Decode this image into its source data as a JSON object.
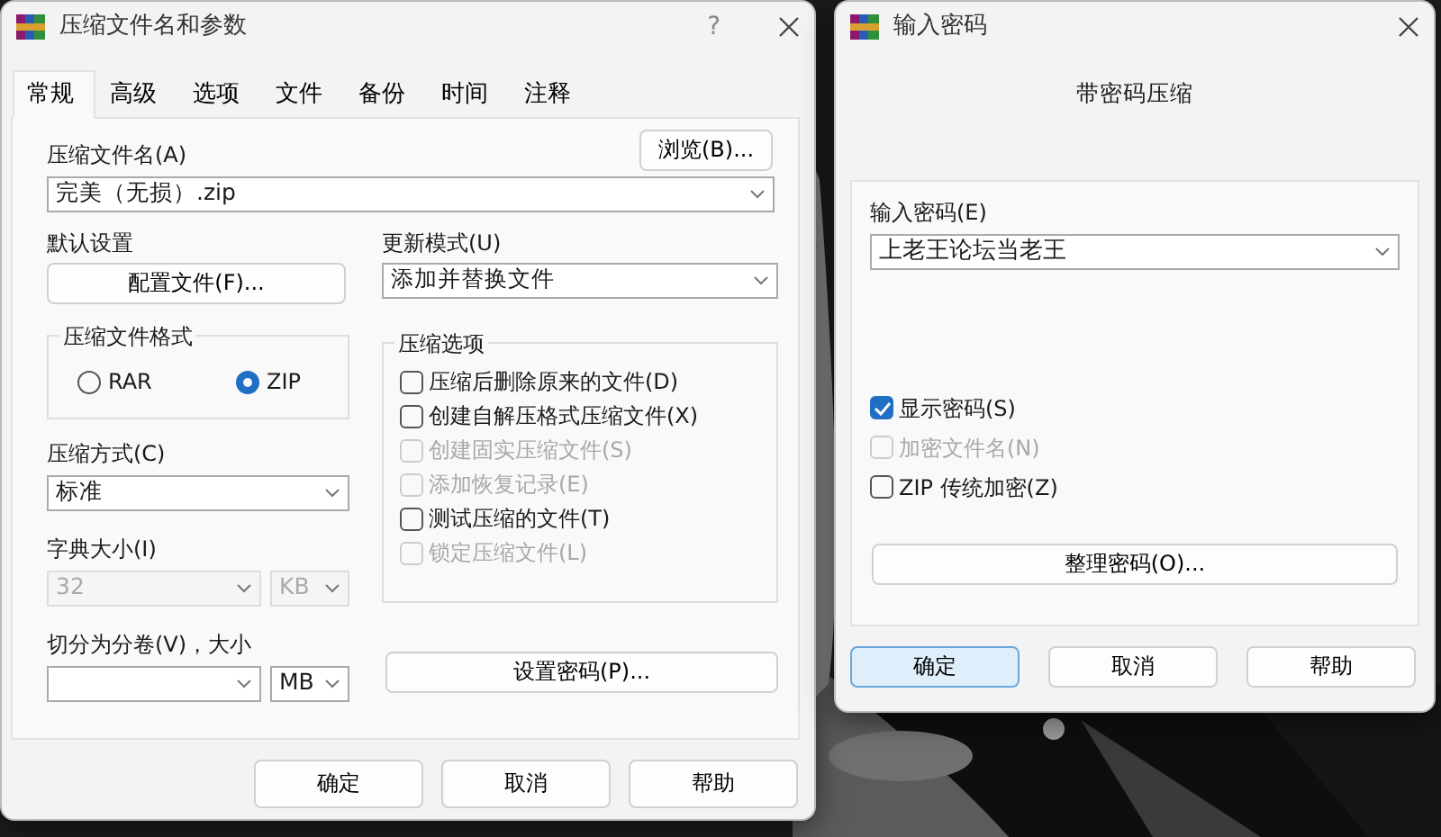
{
  "main_dialog": {
    "title": "压缩文件名和参数",
    "help": "?",
    "tabs": [
      {
        "label": "常规",
        "selected": true
      },
      {
        "label": "高级",
        "selected": false
      },
      {
        "label": "选项",
        "selected": false
      },
      {
        "label": "文件",
        "selected": false
      },
      {
        "label": "备份",
        "selected": false
      },
      {
        "label": "时间",
        "selected": false
      },
      {
        "label": "注释",
        "selected": false
      }
    ],
    "archive_name": {
      "label": "压缩文件名(A)",
      "value": "完美（无损）.zip"
    },
    "browse_button": "浏览(B)...",
    "default_settings": {
      "label": "默认设置",
      "button": "配置文件(F)..."
    },
    "update_mode": {
      "label": "更新模式(U)",
      "value": "添加并替换文件"
    },
    "format": {
      "label": "压缩文件格式",
      "options": [
        {
          "label": "RAR",
          "selected": false
        },
        {
          "label": "ZIP",
          "selected": true
        }
      ]
    },
    "method": {
      "label": "压缩方式(C)",
      "value": "标准"
    },
    "dictionary": {
      "label": "字典大小(I)",
      "value": "32",
      "unit": "KB",
      "disabled": true
    },
    "split": {
      "label": "切分为分卷(V)，大小",
      "unit": "MB"
    },
    "options": {
      "label": "压缩选项",
      "items": [
        {
          "label": "压缩后删除原来的文件(D)",
          "checked": false,
          "disabled": false
        },
        {
          "label": "创建自解压格式压缩文件(X)",
          "checked": false,
          "disabled": false
        },
        {
          "label": "创建固实压缩文件(S)",
          "checked": false,
          "disabled": true
        },
        {
          "label": "添加恢复记录(E)",
          "checked": false,
          "disabled": true
        },
        {
          "label": "测试压缩的文件(T)",
          "checked": false,
          "disabled": false
        },
        {
          "label": "锁定压缩文件(L)",
          "checked": false,
          "disabled": true
        }
      ]
    },
    "password_button": "设置密码(P)...",
    "buttons": [
      {
        "label": "确定",
        "default": false
      },
      {
        "label": "取消",
        "default": false
      },
      {
        "label": "帮助",
        "default": false
      }
    ]
  },
  "password_dialog": {
    "title": "输入密码",
    "heading": "带密码压缩",
    "field": {
      "label": "输入密码(E)",
      "value": "上老王论坛当老王"
    },
    "options": [
      {
        "label": "显示密码(S)",
        "checked": true,
        "disabled": false
      },
      {
        "label": "加密文件名(N)",
        "checked": false,
        "disabled": true
      },
      {
        "label": "ZIP 传统加密(Z)",
        "checked": false,
        "disabled": false
      }
    ],
    "organize_button": "整理密码(O)...",
    "buttons": [
      {
        "label": "确定",
        "default": true
      },
      {
        "label": "取消",
        "default": false
      },
      {
        "label": "帮助",
        "default": false
      }
    ]
  }
}
